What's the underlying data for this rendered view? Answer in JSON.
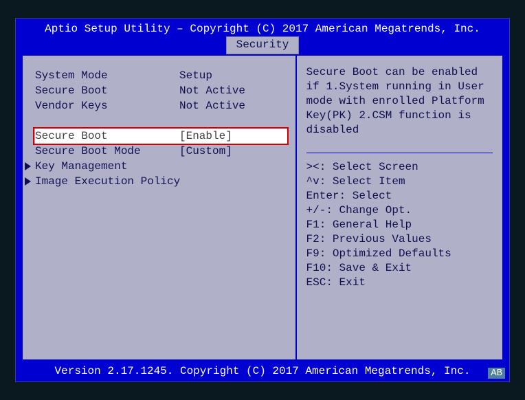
{
  "header": {
    "title": "Aptio Setup Utility – Copyright (C) 2017 American Megatrends, Inc."
  },
  "tab": {
    "current": "Security"
  },
  "info": [
    {
      "label": "System Mode",
      "value": "Setup"
    },
    {
      "label": "Secure Boot",
      "value": "Not Active"
    },
    {
      "label": "Vendor Keys",
      "value": "Not Active"
    }
  ],
  "options": [
    {
      "label": "Secure Boot",
      "value": "[Enable]",
      "selected": true
    },
    {
      "label": "Secure Boot Mode",
      "value": "[Custom]",
      "selected": false
    }
  ],
  "submenus": [
    {
      "label": "Key Management"
    },
    {
      "label": "Image Execution Policy"
    }
  ],
  "help": {
    "text": "Secure Boot can be enabled if 1.System running in User mode with enrolled Platform Key(PK) 2.CSM function is disabled"
  },
  "hotkeys": [
    "><: Select Screen",
    "^v: Select Item",
    "Enter: Select",
    "+/-: Change Opt.",
    "F1: General Help",
    "F2: Previous Values",
    "F9: Optimized Defaults",
    "F10: Save & Exit",
    "ESC: Exit"
  ],
  "footer": {
    "text": "Version 2.17.1245. Copyright (C) 2017 American Megatrends, Inc."
  },
  "badge": "AB"
}
